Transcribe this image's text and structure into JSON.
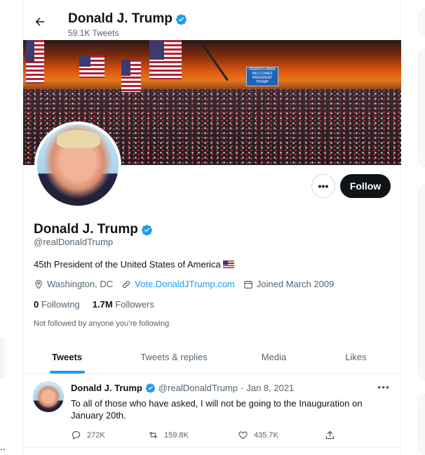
{
  "header": {
    "name": "Donald J. Trump",
    "tweet_count": "59.1K Tweets"
  },
  "banner": {
    "sign_text": "PENNSYLVANIA WELCOMES PRESIDENT TRUMP"
  },
  "profile": {
    "name": "Donald J. Trump",
    "handle": "@realDonaldTrump",
    "bio": "45th President of the United States of America",
    "location": "Washington, DC",
    "website": "Vote.DonaldJTrump.com",
    "joined": "Joined March 2009",
    "following_count": "0",
    "following_label": "Following",
    "followers_count": "1.7M",
    "followers_label": "Followers",
    "not_followed": "Not followed by anyone you’re following",
    "more_label": "•••",
    "follow_label": "Follow"
  },
  "tabs": [
    {
      "label": "Tweets",
      "active": true
    },
    {
      "label": "Tweets & replies",
      "active": false
    },
    {
      "label": "Media",
      "active": false
    },
    {
      "label": "Likes",
      "active": false
    }
  ],
  "tweet": {
    "name": "Donald J. Trump",
    "handle": "@realDonaldTrump",
    "separator": "·",
    "date": "Jan 8, 2021",
    "text": "To all of those who have asked, I will not be going to the Inauguration on January 20th.",
    "replies": "272K",
    "retweets": "159.8K",
    "likes": "435.7K",
    "more": "•••"
  },
  "sidebar_left": {
    "ellipsis": ".."
  },
  "colors": {
    "accent": "#1d9bf0",
    "text": "#0f1419",
    "secondary": "#536471",
    "border": "#eff3f4"
  }
}
